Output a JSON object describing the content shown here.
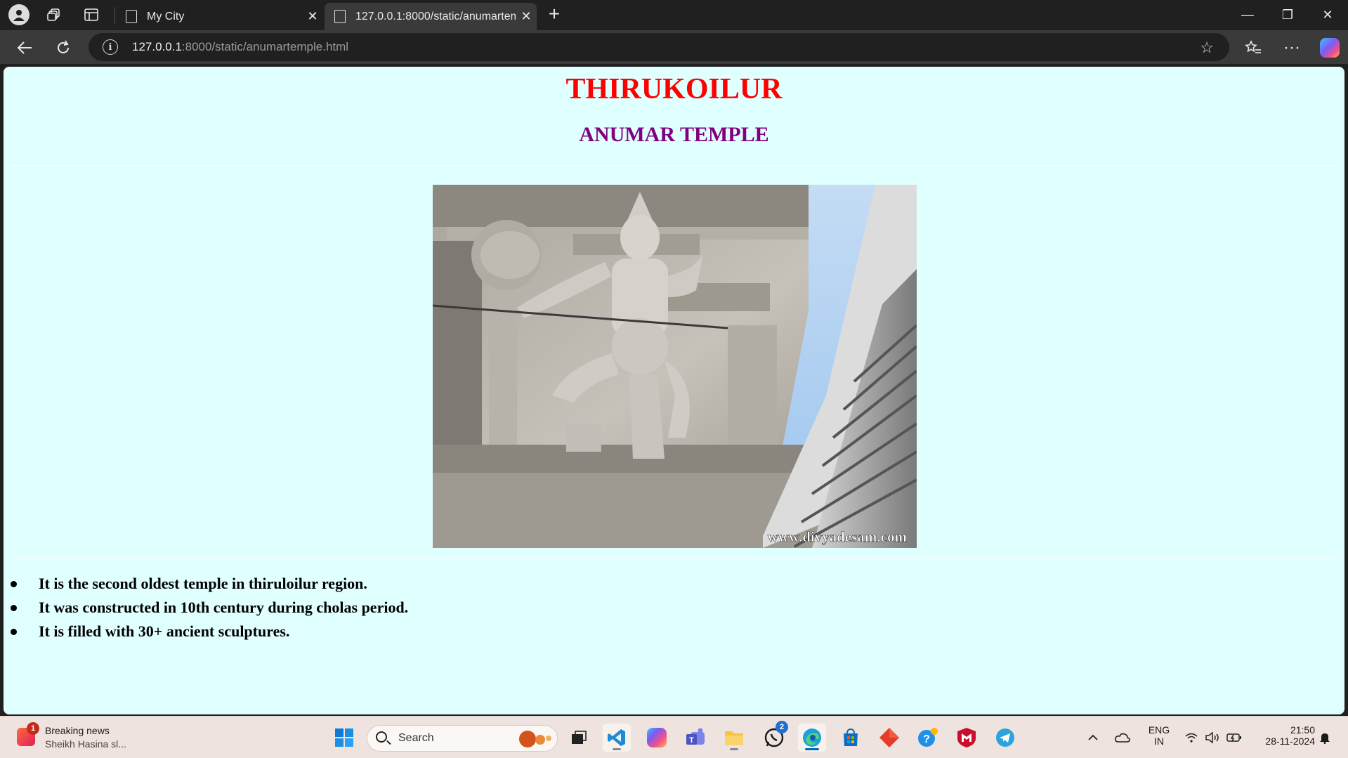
{
  "browser": {
    "tabs": [
      {
        "title": "My City",
        "close": "✕"
      },
      {
        "title": "127.0.0.1:8000/static/anumartemple.html",
        "close": "✕"
      }
    ],
    "new_tab": "+",
    "url_host": "127.0.0.1",
    "url_rest": ":8000/static/anumartemple.html",
    "window_controls": {
      "minimize": "—",
      "restore": "❐",
      "close": "✕"
    }
  },
  "page": {
    "city": "THIRUKOILUR",
    "temple": "ANUMAR TEMPLE",
    "photo": {
      "watermark": "www.divyadesam.com"
    },
    "facts": [
      "It is the second oldest temple in thiruloilur region.",
      "It was constructed in 10th century during cholas period.",
      "It is filled with 30+ ancient sculptures."
    ]
  },
  "taskbar": {
    "news_title": "Breaking news",
    "news_subtitle": "Sheikh Hasina sl...",
    "news_badge": "1",
    "search_placeholder": "Search",
    "teams_badge": "2",
    "language_1": "ENG",
    "language_2": "IN",
    "time": "21:50",
    "date": "28-11-2024"
  }
}
